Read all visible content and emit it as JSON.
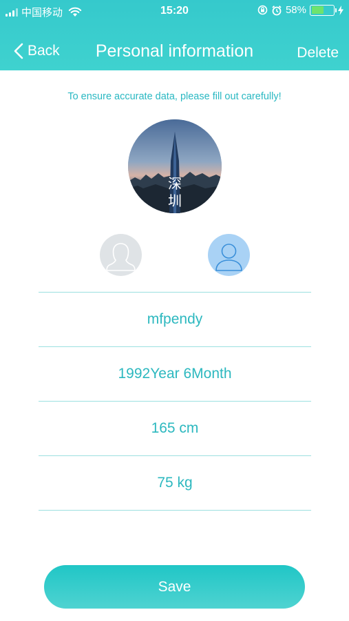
{
  "status_bar": {
    "carrier": "中国移动",
    "time": "15:20",
    "battery": "58%",
    "battery_level": 0.58
  },
  "nav": {
    "back_label": "Back",
    "title": "Personal information",
    "delete_label": "Delete"
  },
  "notice": "To ensure accurate data, please fill out carefully!",
  "avatar": {
    "overlay_text": "深圳"
  },
  "gender": {
    "female_icon": "female-avatar-icon",
    "male_icon": "male-avatar-icon",
    "selected": "male"
  },
  "fields": {
    "nickname": "mfpendy",
    "birth": "1992Year 6Month",
    "height": "165 cm",
    "weight": "75 kg"
  },
  "save_label": "Save",
  "colors": {
    "accent": "#35c9cc",
    "text_accent": "#2cb8bf",
    "divider": "#9be0e0"
  }
}
